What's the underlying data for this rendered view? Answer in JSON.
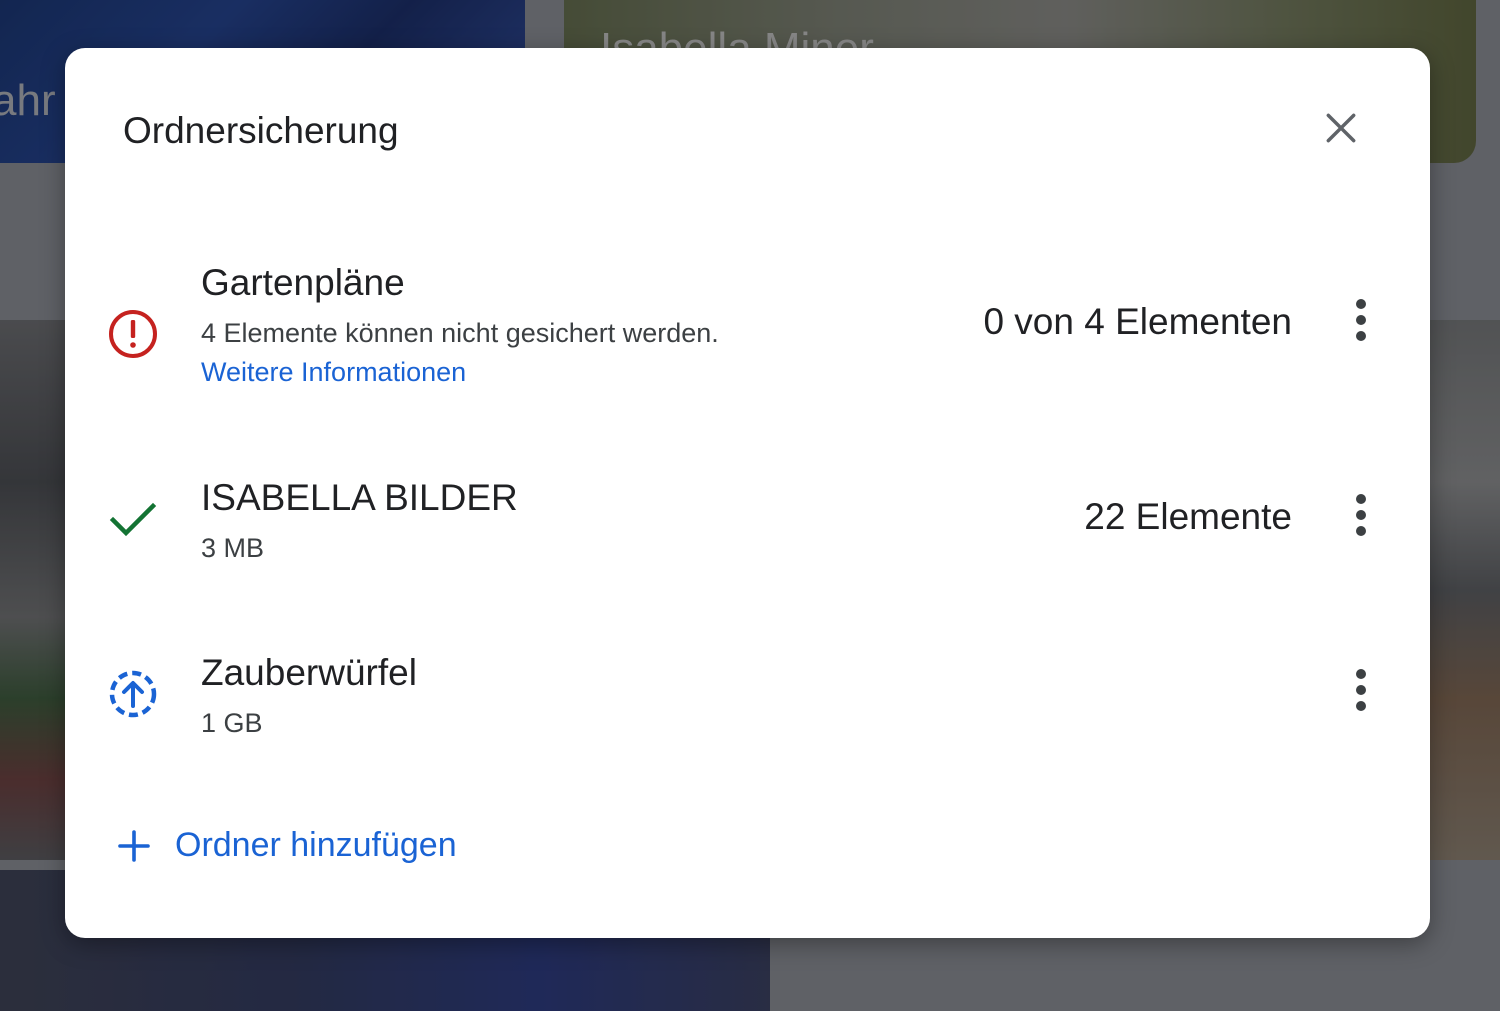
{
  "background": {
    "tile_left_text": "ahr",
    "tile_right_text": "Isabella Miner"
  },
  "dialog": {
    "title": "Ordnersicherung",
    "close_icon": "close-icon",
    "folders": [
      {
        "name": "Gartenpläne",
        "status": "error",
        "status_icon": "error-icon",
        "status_color": "#c5221f",
        "subtitle": "4 Elemente können nicht gesichert werden.",
        "link": "Weitere Informationen",
        "count": "0 von 4 Elementen"
      },
      {
        "name": "ISABELLA BILDER",
        "status": "done",
        "status_icon": "check-icon",
        "status_color": "#137333",
        "subtitle": "3 MB",
        "count": "22 Elemente"
      },
      {
        "name": "Zauberwürfel",
        "status": "uploading",
        "status_icon": "upload-pending-icon",
        "status_color": "#1a63d4",
        "subtitle": "1 GB",
        "count": ""
      }
    ],
    "add_folder_label": "Ordner hinzufügen",
    "accent_color": "#1a63d4"
  }
}
